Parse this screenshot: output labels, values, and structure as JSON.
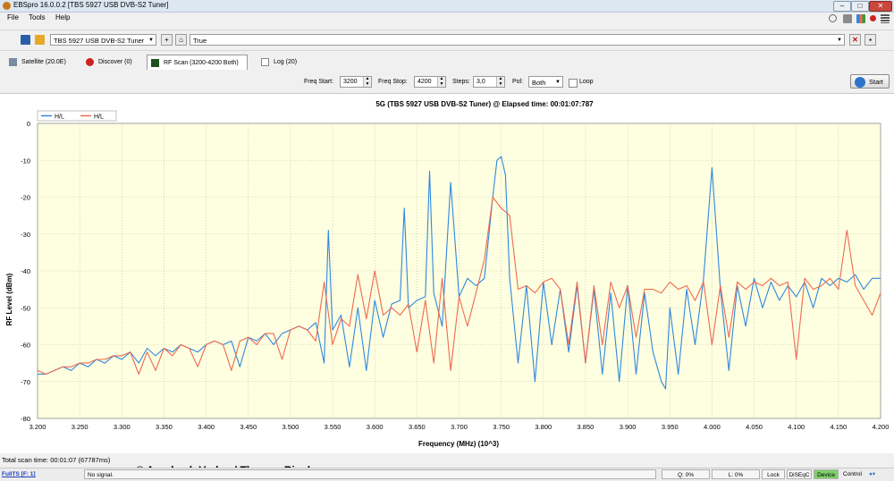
{
  "window": {
    "title": "EBSpro 16.0.0.2 [TBS 5927 USB DVB-S2 Tuner]"
  },
  "menu": {
    "file": "File",
    "tools": "Tools",
    "help": "Help"
  },
  "toolbar": {
    "tuner_select": "TBS 5927 USB DVB-S2 Tuner",
    "filter_select": "True"
  },
  "tabs": {
    "satellite": "Satellite (20.0E)",
    "discover": "Discover (0)",
    "rfscan": "RF Scan (3200-4200 Both)",
    "log": "Log (20)"
  },
  "params": {
    "freq_start_label": "Freq Start:",
    "freq_start_value": "3200",
    "freq_stop_label": "Freq Stop:",
    "freq_stop_value": "4200",
    "steps_label": "Steps:",
    "steps_value": "3,0",
    "pol_label": "Pol:",
    "pol_value": "Both",
    "loop_label": "Loop",
    "start_button": "Start"
  },
  "status": {
    "scan_time": "Total scan time: 00:01:07 (67787ms)",
    "fullts": "FullTS [F: 1]",
    "signal": "No signal.",
    "q": "Q: 0%",
    "l": "L: 0%",
    "lock": "Lock",
    "diseqc": "DiSEqC",
    "device": "Device",
    "control": "Control",
    "watermark": "© Auerbach Verlag / Thomas Riegler"
  },
  "colors": {
    "series_blue": "#2f88e0",
    "series_red": "#ee6a50",
    "plot_bg": "#fefee0"
  },
  "chart_data": {
    "type": "line",
    "title": "5G    (TBS 5927 USB DVB-S2 Tuner) @ Elapsed time: 00:01:07:787",
    "xlabel": "Frequency (MHz) (10^3)",
    "ylabel": "RF Level (dBm)",
    "xlim": [
      3.2,
      4.2
    ],
    "ylim": [
      -80,
      0
    ],
    "x_ticks": [
      "3.200",
      "3.250",
      "3.300",
      "3.350",
      "3.400",
      "3.450",
      "3.500",
      "3.550",
      "3.600",
      "3.650",
      "3.700",
      "3.750",
      "3.800",
      "3.850",
      "3.900",
      "3.950",
      "4.000",
      "4.050",
      "4.100",
      "4.150",
      "4.200"
    ],
    "y_ticks": [
      "0",
      "-10",
      "-20",
      "-30",
      "-40",
      "-50",
      "-60",
      "-70",
      "-80"
    ],
    "grid": true,
    "legend_position": "top-left",
    "series": [
      {
        "name": "H/L",
        "color": "#2f88e0",
        "x": [
          3.2,
          3.21,
          3.22,
          3.23,
          3.24,
          3.25,
          3.26,
          3.27,
          3.28,
          3.29,
          3.3,
          3.31,
          3.32,
          3.33,
          3.34,
          3.35,
          3.36,
          3.37,
          3.38,
          3.39,
          3.4,
          3.41,
          3.42,
          3.43,
          3.44,
          3.45,
          3.46,
          3.47,
          3.48,
          3.49,
          3.5,
          3.51,
          3.52,
          3.53,
          3.54,
          3.545,
          3.55,
          3.56,
          3.57,
          3.58,
          3.59,
          3.6,
          3.61,
          3.62,
          3.63,
          3.635,
          3.64,
          3.65,
          3.66,
          3.665,
          3.67,
          3.68,
          3.69,
          3.7,
          3.71,
          3.72,
          3.73,
          3.74,
          3.745,
          3.75,
          3.755,
          3.76,
          3.77,
          3.78,
          3.79,
          3.8,
          3.81,
          3.82,
          3.83,
          3.84,
          3.85,
          3.86,
          3.87,
          3.88,
          3.89,
          3.9,
          3.91,
          3.92,
          3.93,
          3.94,
          3.945,
          3.95,
          3.96,
          3.97,
          3.98,
          3.99,
          4.0,
          4.01,
          4.02,
          4.03,
          4.04,
          4.05,
          4.06,
          4.07,
          4.08,
          4.09,
          4.1,
          4.11,
          4.12,
          4.13,
          4.14,
          4.15,
          4.16,
          4.17,
          4.18,
          4.19,
          4.2
        ],
        "values": [
          -68,
          -68,
          -67,
          -66,
          -67,
          -65,
          -66,
          -64,
          -65,
          -63,
          -64,
          -62,
          -65,
          -61,
          -63,
          -61,
          -62,
          -60,
          -61,
          -62,
          -60,
          -59,
          -60,
          -59,
          -66,
          -58,
          -59,
          -57,
          -60,
          -57,
          -56,
          -55,
          -56,
          -54,
          -65,
          -29,
          -56,
          -52,
          -66,
          -50,
          -67,
          -48,
          -58,
          -49,
          -48,
          -23,
          -50,
          -48,
          -47,
          -13,
          -46,
          -55,
          -16,
          -47,
          -42,
          -44,
          -42,
          -20,
          -10,
          -9,
          -14,
          -42,
          -65,
          -44,
          -70,
          -43,
          -60,
          -45,
          -62,
          -44,
          -65,
          -45,
          -68,
          -46,
          -70,
          -44,
          -68,
          -46,
          -62,
          -70,
          -72,
          -50,
          -68,
          -45,
          -60,
          -42,
          -12,
          -45,
          -67,
          -44,
          -55,
          -42,
          -50,
          -43,
          -48,
          -44,
          -47,
          -43,
          -50,
          -42,
          -44,
          -42,
          -43,
          -41,
          -45,
          -42,
          -42
        ],
        "notes_peaks": "Major peaks near 3.545, 3.640, 3.665, 3.690, 3.750, 4.000"
      },
      {
        "name": "H/L",
        "color": "#ee6a50",
        "x": [
          3.2,
          3.21,
          3.22,
          3.23,
          3.24,
          3.25,
          3.26,
          3.27,
          3.28,
          3.29,
          3.3,
          3.31,
          3.32,
          3.33,
          3.34,
          3.35,
          3.36,
          3.37,
          3.38,
          3.39,
          3.4,
          3.41,
          3.42,
          3.43,
          3.44,
          3.45,
          3.46,
          3.47,
          3.48,
          3.49,
          3.5,
          3.51,
          3.52,
          3.53,
          3.54,
          3.55,
          3.56,
          3.57,
          3.58,
          3.59,
          3.6,
          3.61,
          3.62,
          3.63,
          3.64,
          3.65,
          3.66,
          3.67,
          3.68,
          3.69,
          3.7,
          3.71,
          3.72,
          3.73,
          3.74,
          3.75,
          3.76,
          3.77,
          3.78,
          3.79,
          3.8,
          3.81,
          3.82,
          3.83,
          3.84,
          3.85,
          3.86,
          3.87,
          3.88,
          3.89,
          3.9,
          3.91,
          3.92,
          3.93,
          3.94,
          3.95,
          3.96,
          3.97,
          3.98,
          3.99,
          4.0,
          4.01,
          4.02,
          4.03,
          4.04,
          4.05,
          4.06,
          4.07,
          4.08,
          4.09,
          4.1,
          4.11,
          4.12,
          4.13,
          4.14,
          4.15,
          4.16,
          4.17,
          4.18,
          4.19,
          4.2
        ],
        "values": [
          -67,
          -68,
          -67,
          -66,
          -66,
          -65,
          -65,
          -64,
          -64,
          -63,
          -63,
          -62,
          -68,
          -62,
          -67,
          -61,
          -63,
          -60,
          -61,
          -66,
          -60,
          -59,
          -60,
          -67,
          -59,
          -58,
          -60,
          -57,
          -57,
          -64,
          -56,
          -55,
          -56,
          -59,
          -43,
          -60,
          -53,
          -55,
          -41,
          -53,
          -40,
          -52,
          -50,
          -52,
          -49,
          -62,
          -48,
          -65,
          -42,
          -67,
          -47,
          -55,
          -46,
          -37,
          -20,
          -23,
          -25,
          -45,
          -44,
          -46,
          -43,
          -42,
          -45,
          -60,
          -43,
          -65,
          -44,
          -60,
          -43,
          -50,
          -44,
          -58,
          -45,
          -45,
          -46,
          -43,
          -45,
          -44,
          -48,
          -43,
          -60,
          -44,
          -58,
          -43,
          -45,
          -43,
          -44,
          -42,
          -44,
          -43,
          -64,
          -42,
          -45,
          -44,
          -42,
          -45,
          -29,
          -44,
          -48,
          -52,
          -46
        ]
      }
    ]
  }
}
